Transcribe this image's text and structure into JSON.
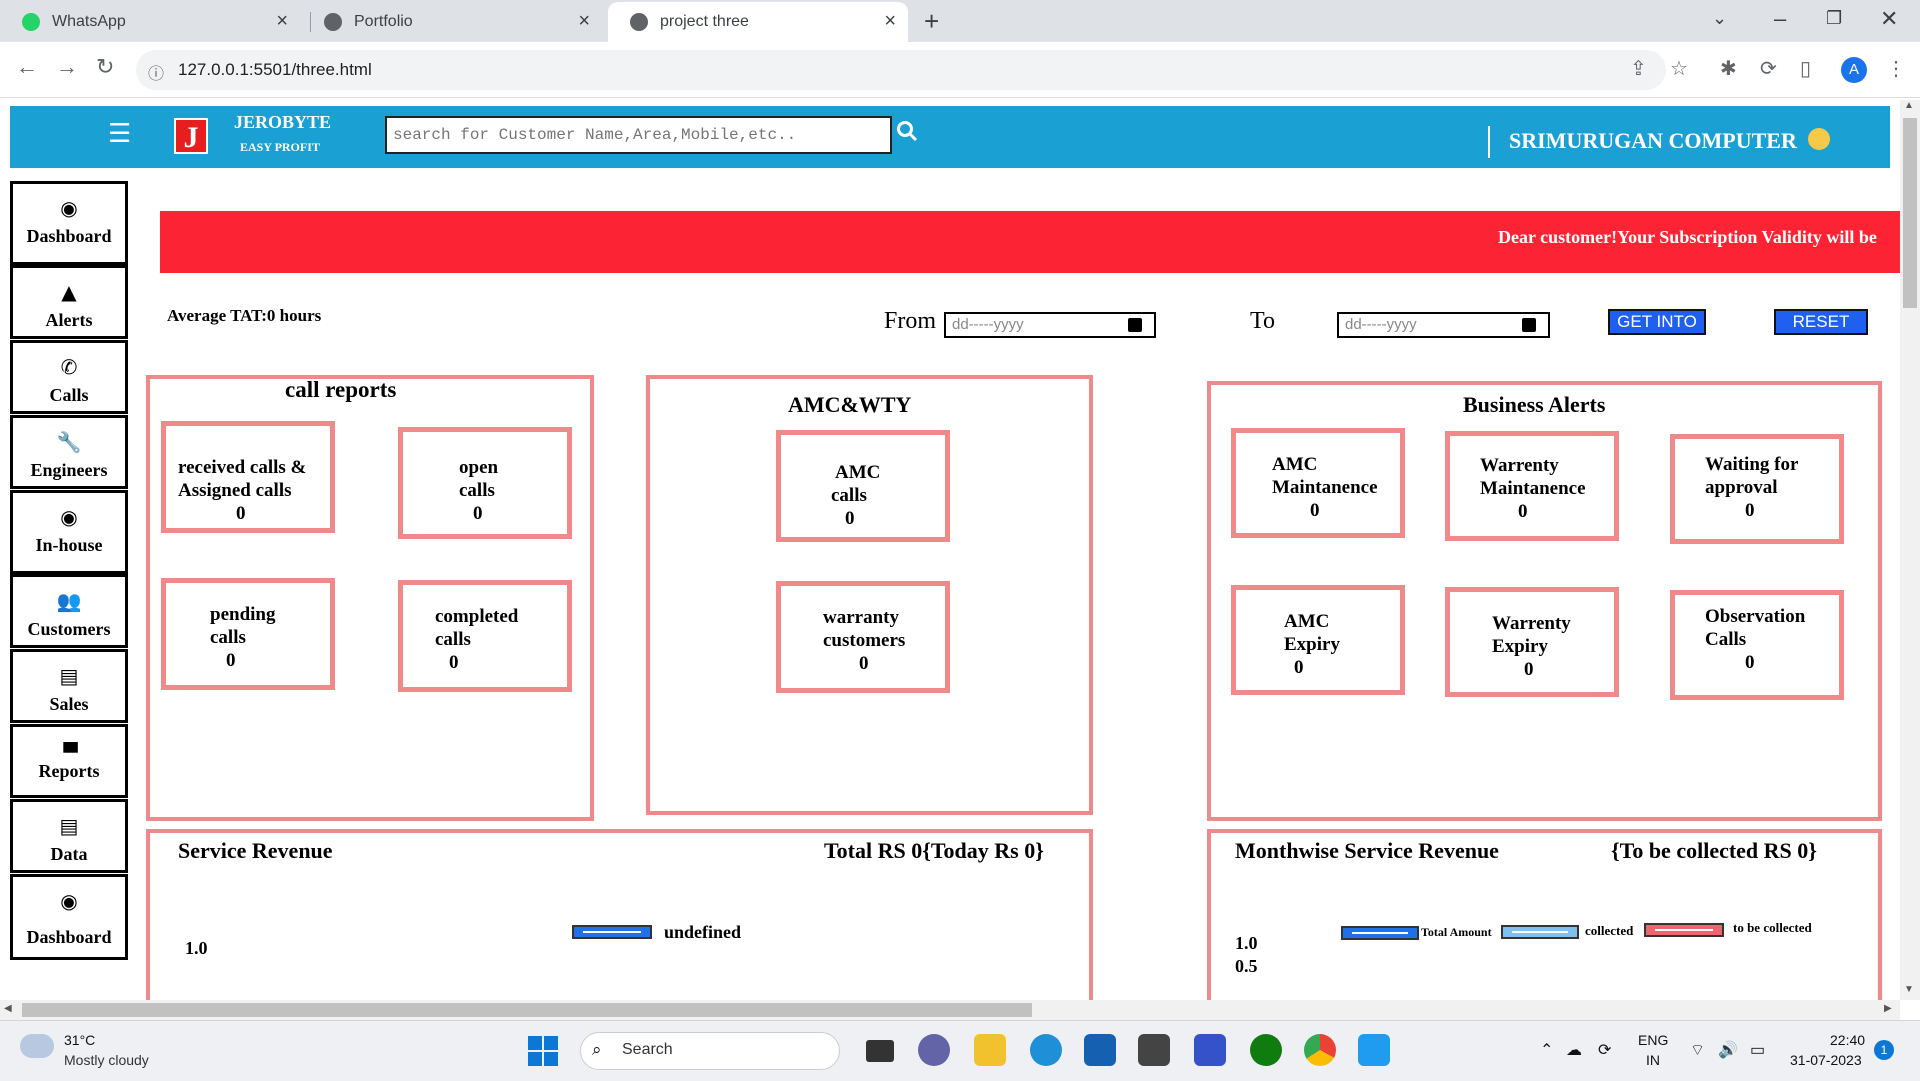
{
  "browser": {
    "tabs": [
      {
        "label": "WhatsApp",
        "active": false
      },
      {
        "label": "Portfolio",
        "active": false
      },
      {
        "label": "project three",
        "active": true
      }
    ],
    "url": "127.0.0.1:5501/three.html",
    "profile_initial": "A"
  },
  "header": {
    "logo_letter": "J",
    "brand": "JEROBYTE",
    "tagline": "EASY PROFIT",
    "search_placeholder": "search for Customer Name,Area,Mobile,etc..",
    "company": "SRIMURUGAN COMPUTER"
  },
  "sidebar": {
    "items": [
      {
        "label": "Dashboard",
        "icon": "dashboard-icon",
        "glyph": "◉"
      },
      {
        "label": "Alerts",
        "icon": "warning-icon",
        "glyph": "▲"
      },
      {
        "label": "Calls",
        "icon": "phone-icon",
        "glyph": "✆"
      },
      {
        "label": "Engineers",
        "icon": "wrench-icon",
        "glyph": "🔧"
      },
      {
        "label": "In-house",
        "icon": "dashboard-icon",
        "glyph": "◉"
      },
      {
        "label": "Customers",
        "icon": "users-icon",
        "glyph": "👥"
      },
      {
        "label": "Sales",
        "icon": "book-icon",
        "glyph": "▤"
      },
      {
        "label": "Reports",
        "icon": "bar-chart-icon",
        "glyph": "▮▮▮"
      },
      {
        "label": "Data",
        "icon": "book-icon",
        "glyph": "▤"
      },
      {
        "label": "Dashboard",
        "icon": "dashboard-icon",
        "glyph": "◉"
      }
    ]
  },
  "banner": {
    "text": "Dear customer!Your Subscription Validity will be"
  },
  "filters": {
    "avg_tat": "Average TAT:0 hours",
    "from_label": "From",
    "to_label": "To",
    "date_placeholder": "dd-----yyyy",
    "get_button": "GET INTO",
    "reset_button": "RESET"
  },
  "call_reports": {
    "title": "call reports",
    "cards": [
      {
        "line1": "received calls &",
        "line2": "Assigned calls",
        "value": "0"
      },
      {
        "line1": "open",
        "line2": "calls",
        "value": "0"
      },
      {
        "line1": "pending",
        "line2": "calls",
        "value": "0"
      },
      {
        "line1": "completed",
        "line2": "calls",
        "value": "0"
      }
    ]
  },
  "amc_wty": {
    "title": "AMC&WTY",
    "cards": [
      {
        "line1": "AMC",
        "line2": "calls",
        "value": "0"
      },
      {
        "line1": "warranty",
        "line2": "customers",
        "value": "0"
      }
    ]
  },
  "business_alerts": {
    "title": "Business Alerts",
    "cards": [
      {
        "line1": "AMC",
        "line2": "Maintanence",
        "value": "0"
      },
      {
        "line1": "Warrenty",
        "line2": "Maintanence",
        "value": "0"
      },
      {
        "line1": "Waiting for",
        "line2": "approval",
        "value": "0"
      },
      {
        "line1": "AMC",
        "line2": "Expiry",
        "value": "0"
      },
      {
        "line1": "Warrenty",
        "line2": "Expiry",
        "value": "0"
      },
      {
        "line1": "Observation",
        "line2": "Calls",
        "value": "0"
      }
    ]
  },
  "service_revenue": {
    "title": "Service Revenue",
    "total": "Total RS 0{Today Rs 0}",
    "legend": "undefined",
    "y_ticks": [
      "1.0"
    ]
  },
  "monthwise_revenue": {
    "title": "Monthwise Service Revenue",
    "to_collect": "{To be collected RS 0}",
    "legend": [
      {
        "label": "Total Amount",
        "color": "#2070e8"
      },
      {
        "label": "collected",
        "color": "#80c0f0"
      },
      {
        "label": "to be collected",
        "color": "#f06470"
      }
    ],
    "y_ticks": [
      "1.0",
      "0.5"
    ]
  },
  "taskbar": {
    "weather_temp": "31°C",
    "weather_desc": "Mostly cloudy",
    "search_label": "Search",
    "lang": "ENG",
    "region": "IN",
    "time": "22:40",
    "date": "31-07-2023",
    "notifications": "1"
  },
  "colors": {
    "header": "#1ba0d3",
    "banner": "#fc2434",
    "card_border": "#f08a8a",
    "button": "#2060f0"
  }
}
